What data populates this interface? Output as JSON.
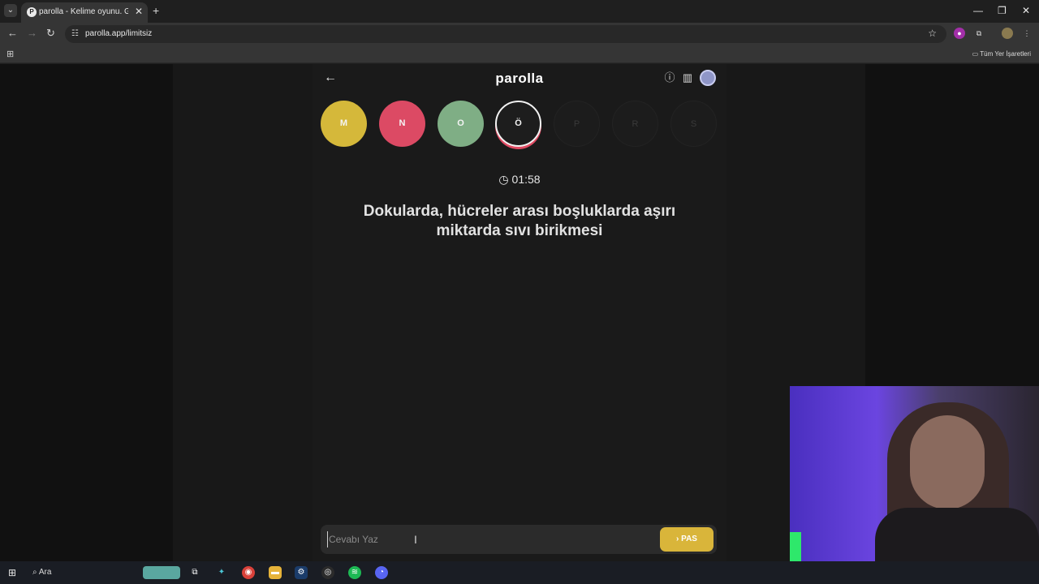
{
  "browser": {
    "tab_title": "parolla - Kelime oyunu. Günlük",
    "url": "parolla.app/limitsiz",
    "bookmarks_all": "Tüm Yer İşaretleri",
    "new_tab": "+"
  },
  "app": {
    "brand": "parolla",
    "letters": [
      {
        "letter": "M",
        "state": "correct-yellow",
        "color": "#d5b83a"
      },
      {
        "letter": "N",
        "state": "wrong",
        "color": "#dc4a64"
      },
      {
        "letter": "O",
        "state": "correct",
        "color": "#7fae85"
      },
      {
        "letter": "Ö",
        "state": "active",
        "color": "#1d1d1d"
      },
      {
        "letter": "P",
        "state": "pending",
        "color": "#1c1c1c"
      },
      {
        "letter": "R",
        "state": "pending",
        "color": "#1c1c1c"
      },
      {
        "letter": "S",
        "state": "pending",
        "color": "#1c1c1c"
      }
    ],
    "timer": "01:58",
    "clue": "Dokularda, hücreler arası boşluklarda aşırı miktarda sıvı birikmesi",
    "answer_placeholder": "Cevabı Yaz",
    "pass_label": "PAS"
  },
  "taskbar": {
    "search_label": "Ara"
  },
  "colors": {
    "accent_pass": "#d9b53a",
    "active_ring": "#e04b63"
  }
}
